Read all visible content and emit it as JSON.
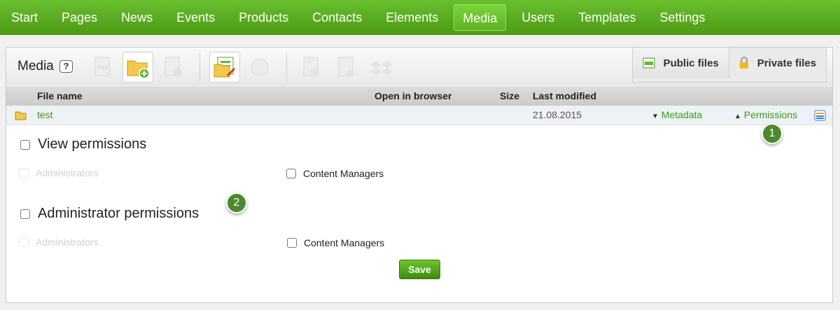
{
  "nav": {
    "items": [
      "Start",
      "Pages",
      "News",
      "Events",
      "Products",
      "Contacts",
      "Elements",
      "Media",
      "Users",
      "Templates",
      "Settings"
    ],
    "active": "Media"
  },
  "toolbar": {
    "title": "Media",
    "help": "?",
    "public_files": "Public files",
    "private_files": "Private files"
  },
  "table": {
    "columns": {
      "file_name": "File name",
      "open_in_browser": "Open in browser",
      "size": "Size",
      "last_modified": "Last modified"
    },
    "row": {
      "name": "test",
      "date": "21.08.2015",
      "metadata": "Metadata",
      "permissions": "Permissions"
    }
  },
  "permissions": {
    "view": {
      "title": "View permissions",
      "administrators": "Administrators",
      "content_managers": "Content Managers"
    },
    "admin": {
      "title": "Administrator permissions",
      "administrators": "Administrators",
      "content_managers": "Content Managers"
    },
    "save": "Save"
  },
  "badges": {
    "one": "1",
    "two": "2"
  },
  "colors": {
    "accent_green": "#4d9a14",
    "link_green": "#3d9b1a",
    "badge_green": "#4b8a2c"
  }
}
